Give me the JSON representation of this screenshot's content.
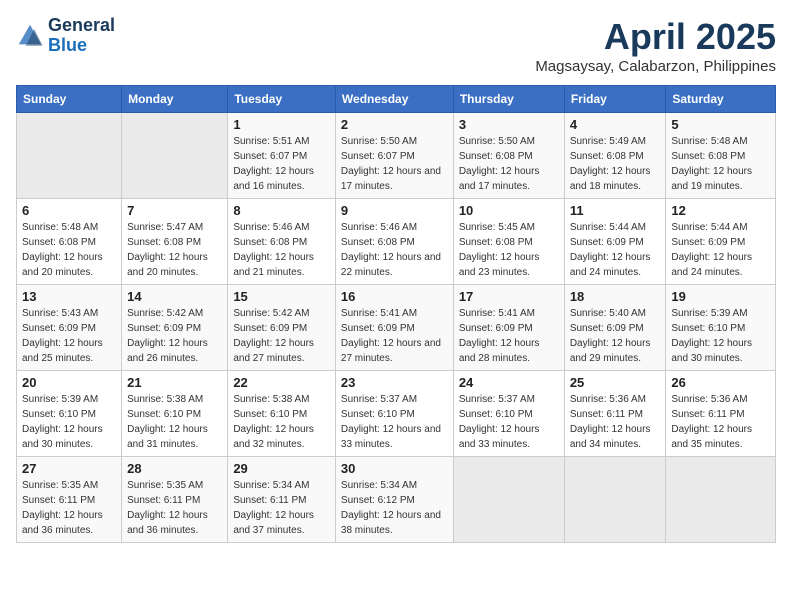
{
  "header": {
    "logo_line1": "General",
    "logo_line2": "Blue",
    "title": "April 2025",
    "subtitle": "Magsaysay, Calabarzon, Philippines"
  },
  "weekdays": [
    "Sunday",
    "Monday",
    "Tuesday",
    "Wednesday",
    "Thursday",
    "Friday",
    "Saturday"
  ],
  "weeks": [
    [
      {
        "day": "",
        "info": ""
      },
      {
        "day": "",
        "info": ""
      },
      {
        "day": "1",
        "info": "Sunrise: 5:51 AM\nSunset: 6:07 PM\nDaylight: 12 hours and 16 minutes."
      },
      {
        "day": "2",
        "info": "Sunrise: 5:50 AM\nSunset: 6:07 PM\nDaylight: 12 hours and 17 minutes."
      },
      {
        "day": "3",
        "info": "Sunrise: 5:50 AM\nSunset: 6:08 PM\nDaylight: 12 hours and 17 minutes."
      },
      {
        "day": "4",
        "info": "Sunrise: 5:49 AM\nSunset: 6:08 PM\nDaylight: 12 hours and 18 minutes."
      },
      {
        "day": "5",
        "info": "Sunrise: 5:48 AM\nSunset: 6:08 PM\nDaylight: 12 hours and 19 minutes."
      }
    ],
    [
      {
        "day": "6",
        "info": "Sunrise: 5:48 AM\nSunset: 6:08 PM\nDaylight: 12 hours and 20 minutes."
      },
      {
        "day": "7",
        "info": "Sunrise: 5:47 AM\nSunset: 6:08 PM\nDaylight: 12 hours and 20 minutes."
      },
      {
        "day": "8",
        "info": "Sunrise: 5:46 AM\nSunset: 6:08 PM\nDaylight: 12 hours and 21 minutes."
      },
      {
        "day": "9",
        "info": "Sunrise: 5:46 AM\nSunset: 6:08 PM\nDaylight: 12 hours and 22 minutes."
      },
      {
        "day": "10",
        "info": "Sunrise: 5:45 AM\nSunset: 6:08 PM\nDaylight: 12 hours and 23 minutes."
      },
      {
        "day": "11",
        "info": "Sunrise: 5:44 AM\nSunset: 6:09 PM\nDaylight: 12 hours and 24 minutes."
      },
      {
        "day": "12",
        "info": "Sunrise: 5:44 AM\nSunset: 6:09 PM\nDaylight: 12 hours and 24 minutes."
      }
    ],
    [
      {
        "day": "13",
        "info": "Sunrise: 5:43 AM\nSunset: 6:09 PM\nDaylight: 12 hours and 25 minutes."
      },
      {
        "day": "14",
        "info": "Sunrise: 5:42 AM\nSunset: 6:09 PM\nDaylight: 12 hours and 26 minutes."
      },
      {
        "day": "15",
        "info": "Sunrise: 5:42 AM\nSunset: 6:09 PM\nDaylight: 12 hours and 27 minutes."
      },
      {
        "day": "16",
        "info": "Sunrise: 5:41 AM\nSunset: 6:09 PM\nDaylight: 12 hours and 27 minutes."
      },
      {
        "day": "17",
        "info": "Sunrise: 5:41 AM\nSunset: 6:09 PM\nDaylight: 12 hours and 28 minutes."
      },
      {
        "day": "18",
        "info": "Sunrise: 5:40 AM\nSunset: 6:09 PM\nDaylight: 12 hours and 29 minutes."
      },
      {
        "day": "19",
        "info": "Sunrise: 5:39 AM\nSunset: 6:10 PM\nDaylight: 12 hours and 30 minutes."
      }
    ],
    [
      {
        "day": "20",
        "info": "Sunrise: 5:39 AM\nSunset: 6:10 PM\nDaylight: 12 hours and 30 minutes."
      },
      {
        "day": "21",
        "info": "Sunrise: 5:38 AM\nSunset: 6:10 PM\nDaylight: 12 hours and 31 minutes."
      },
      {
        "day": "22",
        "info": "Sunrise: 5:38 AM\nSunset: 6:10 PM\nDaylight: 12 hours and 32 minutes."
      },
      {
        "day": "23",
        "info": "Sunrise: 5:37 AM\nSunset: 6:10 PM\nDaylight: 12 hours and 33 minutes."
      },
      {
        "day": "24",
        "info": "Sunrise: 5:37 AM\nSunset: 6:10 PM\nDaylight: 12 hours and 33 minutes."
      },
      {
        "day": "25",
        "info": "Sunrise: 5:36 AM\nSunset: 6:11 PM\nDaylight: 12 hours and 34 minutes."
      },
      {
        "day": "26",
        "info": "Sunrise: 5:36 AM\nSunset: 6:11 PM\nDaylight: 12 hours and 35 minutes."
      }
    ],
    [
      {
        "day": "27",
        "info": "Sunrise: 5:35 AM\nSunset: 6:11 PM\nDaylight: 12 hours and 36 minutes."
      },
      {
        "day": "28",
        "info": "Sunrise: 5:35 AM\nSunset: 6:11 PM\nDaylight: 12 hours and 36 minutes."
      },
      {
        "day": "29",
        "info": "Sunrise: 5:34 AM\nSunset: 6:11 PM\nDaylight: 12 hours and 37 minutes."
      },
      {
        "day": "30",
        "info": "Sunrise: 5:34 AM\nSunset: 6:12 PM\nDaylight: 12 hours and 38 minutes."
      },
      {
        "day": "",
        "info": ""
      },
      {
        "day": "",
        "info": ""
      },
      {
        "day": "",
        "info": ""
      }
    ]
  ]
}
